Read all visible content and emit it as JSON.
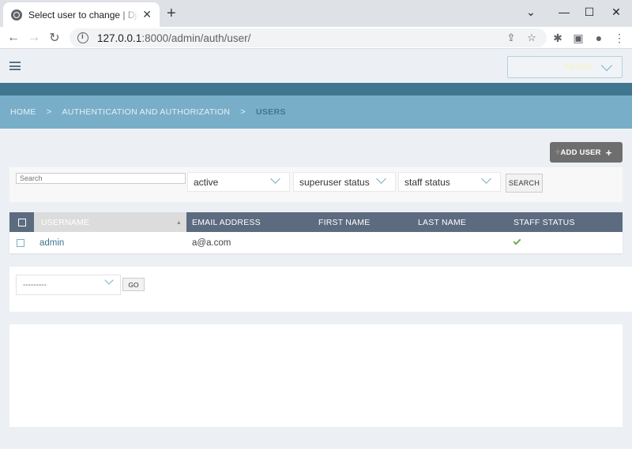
{
  "browser": {
    "tab_title": "Select user to change | Django site admin",
    "tab_close": "✕",
    "new_tab": "+",
    "url_host": "127.0.0.1",
    "url_path": ":8000/admin/auth/user/",
    "window_controls": [
      "⌄",
      "—",
      "☐",
      "✕"
    ]
  },
  "admin": {
    "user_menu_label": "ADMIN",
    "breadcrumbs": {
      "home": "HOME",
      "app": "AUTHENTICATION AND AUTHORIZATION",
      "current": "USERS",
      "separator": ">"
    },
    "add_button": {
      "label": "ADD USER",
      "plus": "+"
    },
    "search": {
      "placeholder": "Search"
    },
    "filters": [
      "active",
      "superuser status",
      "staff status"
    ],
    "search_button": "SEARCH",
    "table": {
      "columns": [
        "USERNAME",
        "EMAIL ADDRESS",
        "FIRST NAME",
        "LAST NAME",
        "STAFF STATUS"
      ],
      "sorted_column_marker": "▲",
      "rows": [
        {
          "username": "admin",
          "email": "a@a.com",
          "first_name": "",
          "last_name": "",
          "staff_status": true
        }
      ]
    },
    "action_select_value": "---------",
    "go_button": "GO"
  },
  "colors": {
    "header_dark": "#417690",
    "breadcrumb_bg": "#79aec8",
    "table_header": "#5c6b7f",
    "link": "#417690",
    "check_green": "#6cb057"
  }
}
